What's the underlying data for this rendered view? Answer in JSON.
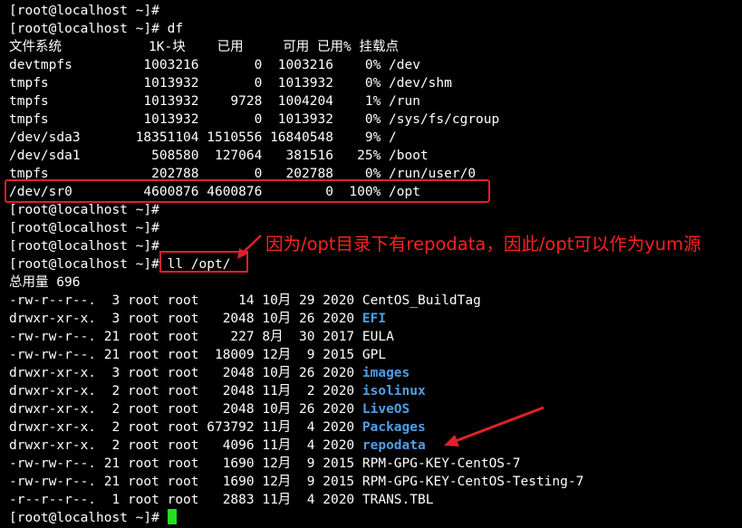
{
  "terminal": {
    "lines": [
      "[root@localhost ~]#",
      "[root@localhost ~]# df",
      "文件系统           1K-块    已用     可用 已用% 挂载点",
      "devtmpfs         1003216       0  1003216    0% /dev",
      "tmpfs            1013932       0  1013932    0% /dev/shm",
      "tmpfs            1013932    9728  1004204    1% /run",
      "tmpfs            1013932       0  1013932    0% /sys/fs/cgroup",
      "/dev/sda3       18351104 1510556 16840548    9% /",
      "/dev/sda1         508580  127064   381516   25% /boot",
      "tmpfs             202788       0   202788    0% /run/user/0",
      "/dev/sr0         4600876 4600876        0  100% /opt",
      "[root@localhost ~]#",
      "[root@localhost ~]#",
      "[root@localhost ~]#",
      "[root@localhost ~]# ll /opt/",
      "总用量 696"
    ],
    "listing": [
      {
        "prefix": "-rw-r--r--.  3 root root     14 10月 29 2020 ",
        "name": "CentOS_BuildTag",
        "is_dir": false
      },
      {
        "prefix": "drwxr-xr-x.  3 root root   2048 10月 26 2020 ",
        "name": "EFI",
        "is_dir": true
      },
      {
        "prefix": "-rw-rw-r--. 21 root root    227 8月  30 2017 ",
        "name": "EULA",
        "is_dir": false
      },
      {
        "prefix": "-rw-rw-r--. 21 root root  18009 12月  9 2015 ",
        "name": "GPL",
        "is_dir": false
      },
      {
        "prefix": "drwxr-xr-x.  3 root root   2048 10月 26 2020 ",
        "name": "images",
        "is_dir": true
      },
      {
        "prefix": "drwxr-xr-x.  2 root root   2048 11月  2 2020 ",
        "name": "isolinux",
        "is_dir": true
      },
      {
        "prefix": "drwxr-xr-x.  2 root root   2048 10月 26 2020 ",
        "name": "LiveOS",
        "is_dir": true
      },
      {
        "prefix": "drwxr-xr-x.  2 root root 673792 11月  4 2020 ",
        "name": "Packages",
        "is_dir": true
      },
      {
        "prefix": "drwxr-xr-x.  2 root root   4096 11月  4 2020 ",
        "name": "repodata",
        "is_dir": true
      },
      {
        "prefix": "-rw-rw-r--. 21 root root   1690 12月  9 2015 ",
        "name": "RPM-GPG-KEY-CentOS-7",
        "is_dir": false
      },
      {
        "prefix": "-rw-rw-r--. 21 root root   1690 12月  9 2015 ",
        "name": "RPM-GPG-KEY-CentOS-Testing-7",
        "is_dir": false
      },
      {
        "prefix": "-r--r--r--.  1 root root   2883 11月  4 2020 ",
        "name": "TRANS.TBL",
        "is_dir": false
      }
    ],
    "prompt": "[root@localhost ~]# "
  },
  "annotation": {
    "text": "因为/opt目录下有repodata，因此/opt可以作为yum源"
  },
  "colors": {
    "background": "#000000",
    "text": "#ffffff",
    "directory": "#4f9fe8",
    "annotation": "#ff2020",
    "cursor": "#20e020"
  }
}
